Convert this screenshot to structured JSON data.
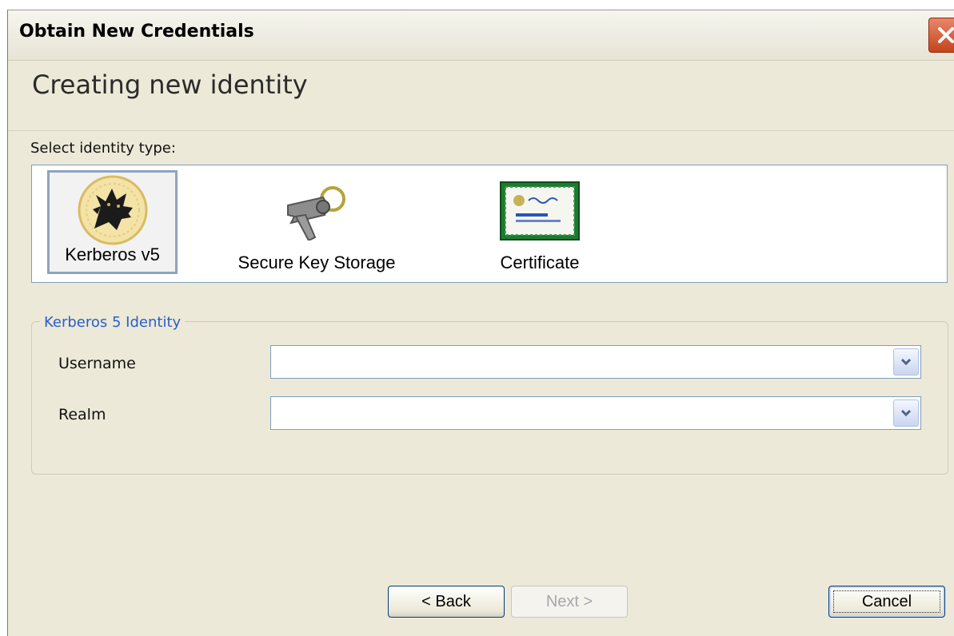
{
  "window": {
    "title": "Obtain New Credentials"
  },
  "page": {
    "heading": "Creating new identity",
    "select_label": "Select identity type:"
  },
  "identity_types": [
    {
      "label": "Kerberos v5",
      "icon": "kerberos-dog-icon",
      "selected": true
    },
    {
      "label": "Secure Key Storage",
      "icon": "keys-icon",
      "selected": false
    },
    {
      "label": "Certificate",
      "icon": "certificate-icon",
      "selected": false
    }
  ],
  "group": {
    "legend": "Kerberos 5 Identity",
    "fields": [
      {
        "label": "Username",
        "value": "",
        "icon": "chevron-down-icon"
      },
      {
        "label": "Realm",
        "value": "",
        "icon": "chevron-down-icon"
      }
    ]
  },
  "buttons": {
    "back": "< Back",
    "next": "Next >",
    "cancel": "Cancel"
  },
  "colors": {
    "dialog_background": "#ece9d8",
    "group_legend": "#2a5fc6",
    "close_button": "#c3451c"
  }
}
